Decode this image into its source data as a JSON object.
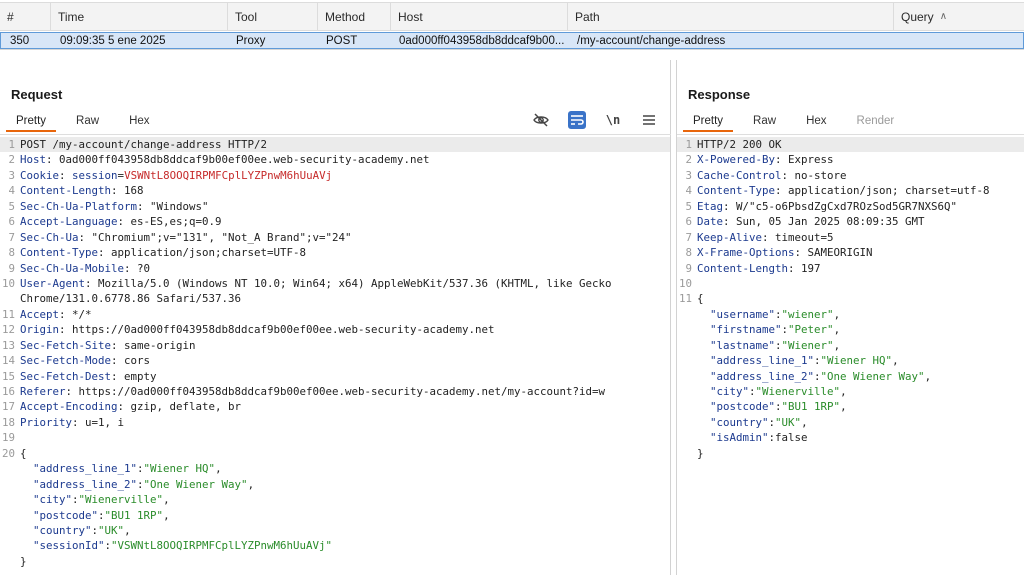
{
  "history": {
    "columns": [
      {
        "label": "#"
      },
      {
        "label": "Time"
      },
      {
        "label": "Tool"
      },
      {
        "label": "Method"
      },
      {
        "label": "Host"
      },
      {
        "label": "Path"
      },
      {
        "label": "Query"
      }
    ],
    "row": {
      "num": "350",
      "time": "09:09:35 5 ene 2025",
      "tool": "Proxy",
      "method": "POST",
      "host": "0ad000ff043958db8ddcaf9b00...",
      "path": "/my-account/change-address"
    }
  },
  "request": {
    "title": "Request",
    "tabs": [
      "Pretty",
      "Raw",
      "Hex"
    ],
    "active_tab": "Pretty",
    "icons": [
      "eye-slash-icon",
      "wrap-lines-icon",
      "newline-icon",
      "menu-icon"
    ],
    "lines": [
      {
        "n": "1",
        "text": "POST /my-account/change-address HTTP/2"
      },
      {
        "n": "2",
        "h": "Host",
        "v": "0ad000ff043958db8ddcaf9b00ef00ee.web-security-academy.net"
      },
      {
        "n": "3",
        "h": "Cookie",
        "ck": "session",
        "cv": "VSWNtL8OOQIRPMFCplLYZPnwM6hUuAVj"
      },
      {
        "n": "4",
        "h": "Content-Length",
        "v": "168"
      },
      {
        "n": "5",
        "h": "Sec-Ch-Ua-Platform",
        "v": "\"Windows\""
      },
      {
        "n": "6",
        "h": "Accept-Language",
        "v": "es-ES,es;q=0.9"
      },
      {
        "n": "7",
        "h": "Sec-Ch-Ua",
        "v": "\"Chromium\";v=\"131\", \"Not_A Brand\";v=\"24\""
      },
      {
        "n": "8",
        "h": "Content-Type",
        "v": "application/json;charset=UTF-8"
      },
      {
        "n": "9",
        "h": "Sec-Ch-Ua-Mobile",
        "v": "?0"
      },
      {
        "n": "10",
        "h": "User-Agent",
        "v": "Mozilla/5.0 (Windows NT 10.0; Win64; x64) AppleWebKit/537.36 (KHTML, like Gecko"
      },
      {
        "n": "",
        "text": "Chrome/131.0.6778.86 Safari/537.36"
      },
      {
        "n": "11",
        "h": "Accept",
        "v": "*/*"
      },
      {
        "n": "12",
        "h": "Origin",
        "v": "https://0ad000ff043958db8ddcaf9b00ef00ee.web-security-academy.net"
      },
      {
        "n": "13",
        "h": "Sec-Fetch-Site",
        "v": "same-origin"
      },
      {
        "n": "14",
        "h": "Sec-Fetch-Mode",
        "v": "cors"
      },
      {
        "n": "15",
        "h": "Sec-Fetch-Dest",
        "v": "empty"
      },
      {
        "n": "16",
        "h": "Referer",
        "v": "https://0ad000ff043958db8ddcaf9b00ef00ee.web-security-academy.net/my-account?id=w"
      },
      {
        "n": "17",
        "h": "Accept-Encoding",
        "v": "gzip, deflate, br"
      },
      {
        "n": "18",
        "h": "Priority",
        "v": "u=1, i"
      },
      {
        "n": "19",
        "text": ""
      },
      {
        "n": "20",
        "text": "{"
      },
      {
        "n": "",
        "jk": "\"address_line_1\"",
        "jv": "\"Wiener HQ\"",
        "end": ","
      },
      {
        "n": "",
        "jk": "\"address_line_2\"",
        "jv": "\"One Wiener Way\"",
        "end": ","
      },
      {
        "n": "",
        "jk": "\"city\"",
        "jv": "\"Wienerville\"",
        "end": ","
      },
      {
        "n": "",
        "jk": "\"postcode\"",
        "jv": "\"BU1 1RP\"",
        "end": ","
      },
      {
        "n": "",
        "jk": "\"country\"",
        "jv": "\"UK\"",
        "end": ","
      },
      {
        "n": "",
        "jk": "\"sessionId\"",
        "jv": "\"VSWNtL8OOQIRPMFCplLYZPnwM6hUuAVj\"",
        "end": ""
      },
      {
        "n": "",
        "text": "}"
      }
    ]
  },
  "response": {
    "title": "Response",
    "tabs": [
      "Pretty",
      "Raw",
      "Hex",
      "Render"
    ],
    "active_tab": "Pretty",
    "lines": [
      {
        "n": "1",
        "text": "HTTP/2 200 OK"
      },
      {
        "n": "2",
        "h": "X-Powered-By",
        "v": "Express"
      },
      {
        "n": "3",
        "h": "Cache-Control",
        "v": "no-store"
      },
      {
        "n": "4",
        "h": "Content-Type",
        "v": "application/json; charset=utf-8"
      },
      {
        "n": "5",
        "h": "Etag",
        "v": "W/\"c5-o6PbsdZgCxd7ROzSod5GR7NXS6Q\""
      },
      {
        "n": "6",
        "h": "Date",
        "v": "Sun, 05 Jan 2025 08:09:35 GMT"
      },
      {
        "n": "7",
        "h": "Keep-Alive",
        "v": "timeout=5"
      },
      {
        "n": "8",
        "h": "X-Frame-Options",
        "v": "SAMEORIGIN"
      },
      {
        "n": "9",
        "h": "Content-Length",
        "v": "197"
      },
      {
        "n": "10",
        "text": ""
      },
      {
        "n": "11",
        "text": "{"
      },
      {
        "n": "",
        "jk": "\"username\"",
        "jv": "\"wiener\"",
        "end": ","
      },
      {
        "n": "",
        "jk": "\"firstname\"",
        "jv": "\"Peter\"",
        "end": ","
      },
      {
        "n": "",
        "jk": "\"lastname\"",
        "jv": "\"Wiener\"",
        "end": ","
      },
      {
        "n": "",
        "jk": "\"address_line_1\"",
        "jv": "\"Wiener HQ\"",
        "end": ","
      },
      {
        "n": "",
        "jk": "\"address_line_2\"",
        "jv": "\"One Wiener Way\"",
        "end": ","
      },
      {
        "n": "",
        "jk": "\"city\"",
        "jv": "\"Wienerville\"",
        "end": ","
      },
      {
        "n": "",
        "jk": "\"postcode\"",
        "jv": "\"BU1 1RP\"",
        "end": ","
      },
      {
        "n": "",
        "jk": "\"country\"",
        "jv": "\"UK\"",
        "end": ","
      },
      {
        "n": "",
        "jk": "\"isAdmin\"",
        "jv": "false",
        "end": "",
        "raw": true
      },
      {
        "n": "",
        "text": "}"
      }
    ]
  }
}
